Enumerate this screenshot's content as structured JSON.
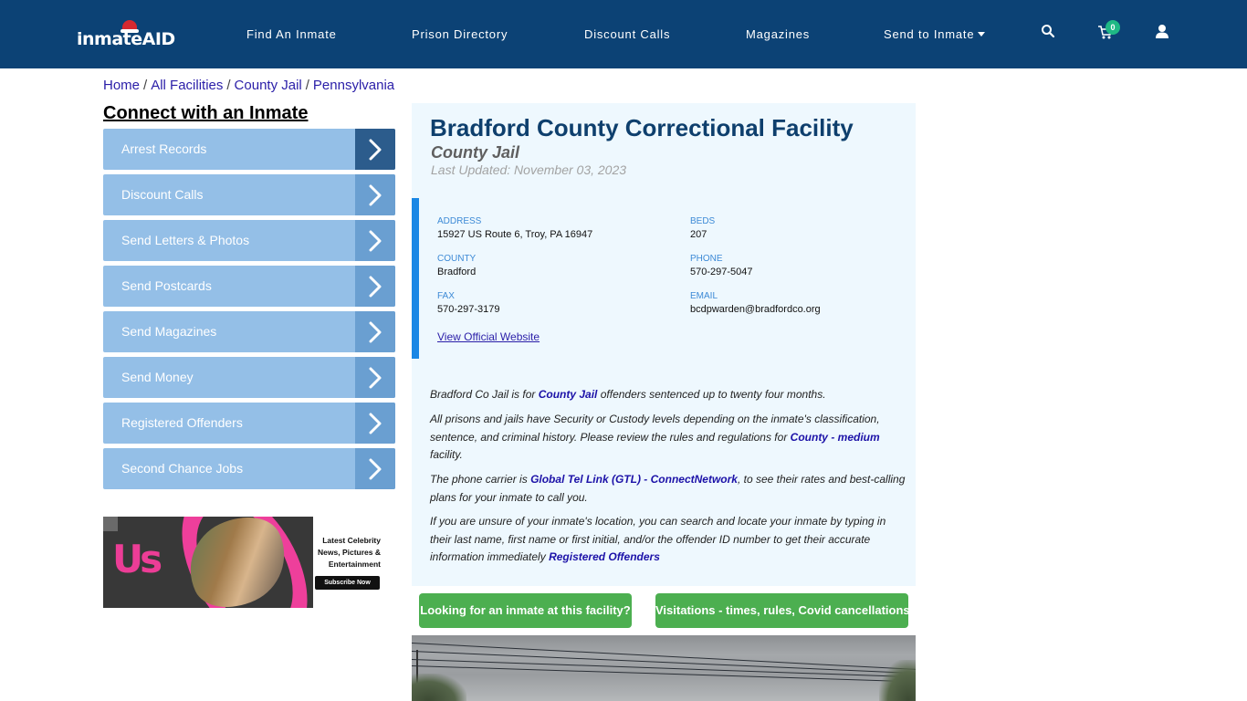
{
  "header": {
    "logo_text_main": "inmate",
    "logo_text_accent": "AID",
    "nav": [
      {
        "label": "Find An Inmate"
      },
      {
        "label": "Prison Directory"
      },
      {
        "label": "Discount Calls"
      },
      {
        "label": "Magazines"
      },
      {
        "label": "Send to Inmate",
        "has_dropdown": true
      }
    ],
    "icons": [
      "search-icon",
      "cart-icon",
      "user-icon"
    ],
    "cart_count": "0",
    "colors": {
      "background": "#0c4275",
      "badge": "#1fb985"
    }
  },
  "breadcrumb": {
    "items": [
      "Home",
      "All Facilities",
      "County Jail",
      "Pennsylvania"
    ],
    "separator": "/"
  },
  "sidebar": {
    "title": "Connect with an Inmate",
    "items": [
      {
        "label": "Arrest Records",
        "active": true
      },
      {
        "label": "Discount Calls"
      },
      {
        "label": "Send Letters & Photos"
      },
      {
        "label": "Send Postcards"
      },
      {
        "label": "Send Magazines"
      },
      {
        "label": "Send Money"
      },
      {
        "label": "Registered Offenders"
      },
      {
        "label": "Second Chance Jobs"
      }
    ],
    "ad": {
      "brand": "Us",
      "tagline_1": "Latest Celebrity",
      "tagline_2": "News, Pictures &",
      "tagline_3": "Entertainment",
      "button": "Subscribe Now"
    }
  },
  "facility": {
    "name": "Bradford County Correctional Facility",
    "type": "County Jail",
    "last_updated": "Last Updated: November 03, 2023",
    "info": {
      "address_label": "ADDRESS",
      "address": "15927 US Route 6, Troy, PA 16947",
      "beds_label": "BEDS",
      "beds": "207",
      "county_label": "COUNTY",
      "county": "Bradford",
      "phone_label": "PHONE",
      "phone": "570-297-5047",
      "fax_label": "FAX",
      "fax": "570-297-3179",
      "email_label": "EMAIL",
      "email": "bcdpwarden@bradfordco.org",
      "website_link": "View Official Website"
    },
    "paragraphs": {
      "p1_a": "Bradford Co Jail is for ",
      "p1_link": "County Jail",
      "p1_b": " offenders sentenced up to twenty four months.",
      "p2_a": "All prisons and jails have Security or Custody levels depending on the inmate's classification, sentence, and criminal history. Please review the rules and regulations for ",
      "p2_link": "County - medium",
      "p2_b": " facility.",
      "p3_a": "The phone carrier is ",
      "p3_link": "Global Tel Link (GTL) - ConnectNetwork",
      "p3_b": ", to see their rates and best-calling plans for your inmate to call you.",
      "p4_a": "If you are unsure of your inmate's location, you can search and locate your inmate by typing in their last name, first name or first initial, and/or the offender ID number to get their accurate information immediately ",
      "p4_link": "Registered Offenders"
    },
    "buttons": {
      "find_inmate": "Looking for an inmate at this facility?",
      "visitations": "Visitations - times, rules, Covid cancellations"
    },
    "colors": {
      "title": "#0e3f6d",
      "accent_bar": "#1a87e5",
      "button": "#4caf50",
      "card_bg": "#eef8fe"
    }
  }
}
